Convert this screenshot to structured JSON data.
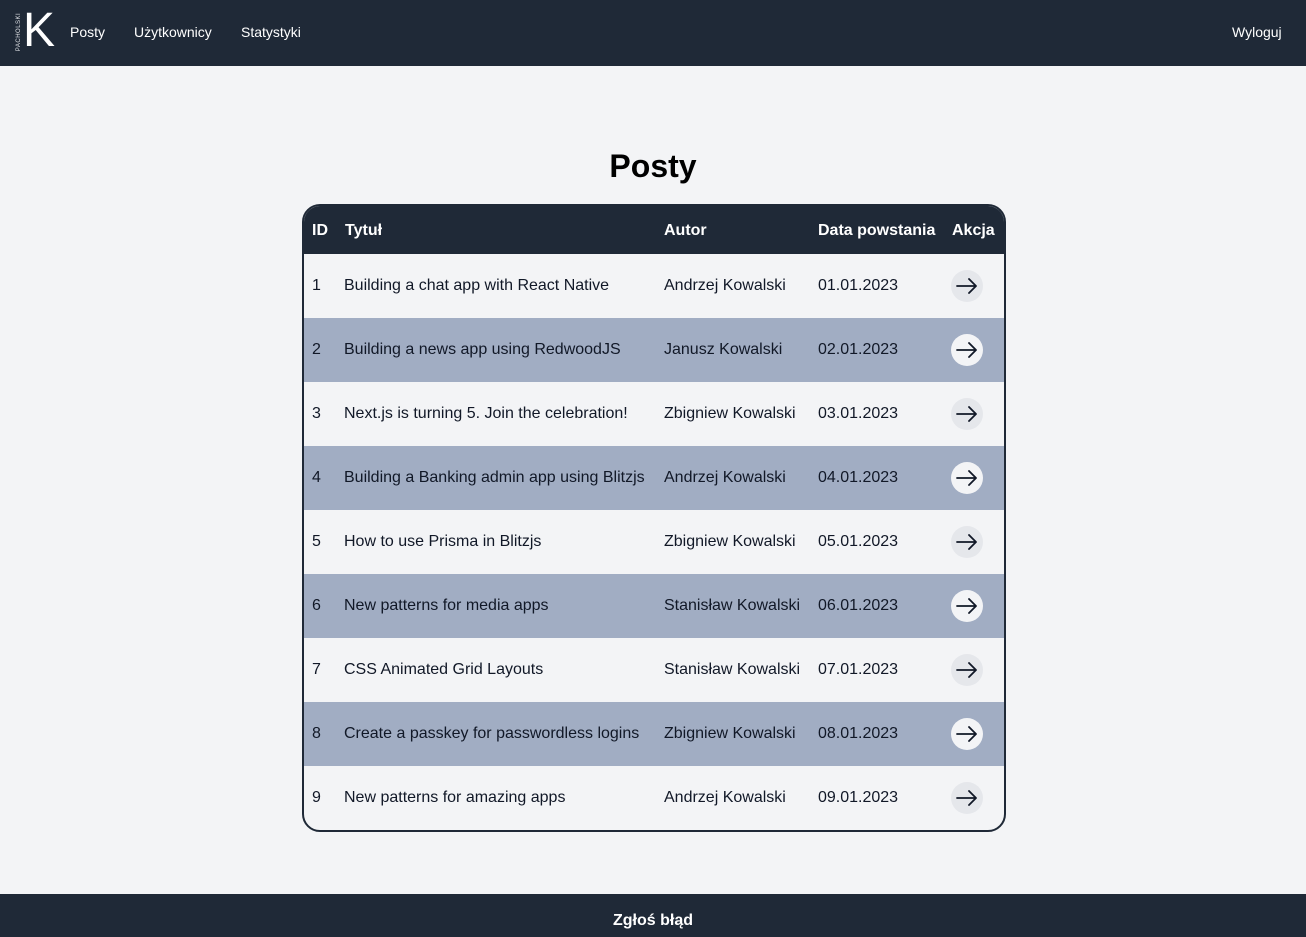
{
  "navbar": {
    "logo_small": "PACHOLSKI",
    "logo_letter": "K",
    "items": [
      {
        "label": "Posty"
      },
      {
        "label": "Użytkownicy"
      },
      {
        "label": "Statystyki"
      }
    ],
    "logout_label": "Wyloguj"
  },
  "main": {
    "title": "Posty",
    "table": {
      "headers": {
        "id": "ID",
        "title": "Tytuł",
        "author": "Autor",
        "date": "Data powstania",
        "action": "Akcja"
      },
      "rows": [
        {
          "id": "1",
          "title": "Building a chat app with React Native",
          "author": "Andrzej Kowalski",
          "date": "01.01.2023"
        },
        {
          "id": "2",
          "title": "Building a news app using RedwoodJS",
          "author": "Janusz Kowalski",
          "date": "02.01.2023"
        },
        {
          "id": "3",
          "title": "Next.js is turning 5. Join the celebration!",
          "author": "Zbigniew Kowalski",
          "date": "03.01.2023"
        },
        {
          "id": "4",
          "title": "Building a Banking admin app using Blitzjs",
          "author": "Andrzej Kowalski",
          "date": "04.01.2023"
        },
        {
          "id": "5",
          "title": "How to use Prisma in Blitzjs",
          "author": "Zbigniew Kowalski",
          "date": "05.01.2023"
        },
        {
          "id": "6",
          "title": "New patterns for media apps",
          "author": "Stanisław Kowalski",
          "date": "06.01.2023"
        },
        {
          "id": "7",
          "title": "CSS Animated Grid Layouts",
          "author": "Stanisław Kowalski",
          "date": "07.01.2023"
        },
        {
          "id": "8",
          "title": "Create a passkey for passwordless logins",
          "author": "Zbigniew Kowalski",
          "date": "08.01.2023"
        },
        {
          "id": "9",
          "title": "New patterns for amazing apps",
          "author": "Andrzej Kowalski",
          "date": "09.01.2023"
        }
      ],
      "action_icon": "arrow-right-icon"
    }
  },
  "footer": {
    "report_label": "Zgłoś błąd"
  },
  "colors": {
    "navbar_bg": "#1f2937",
    "page_bg": "#f3f4f6",
    "alt_row_bg": "#a1adc3"
  }
}
